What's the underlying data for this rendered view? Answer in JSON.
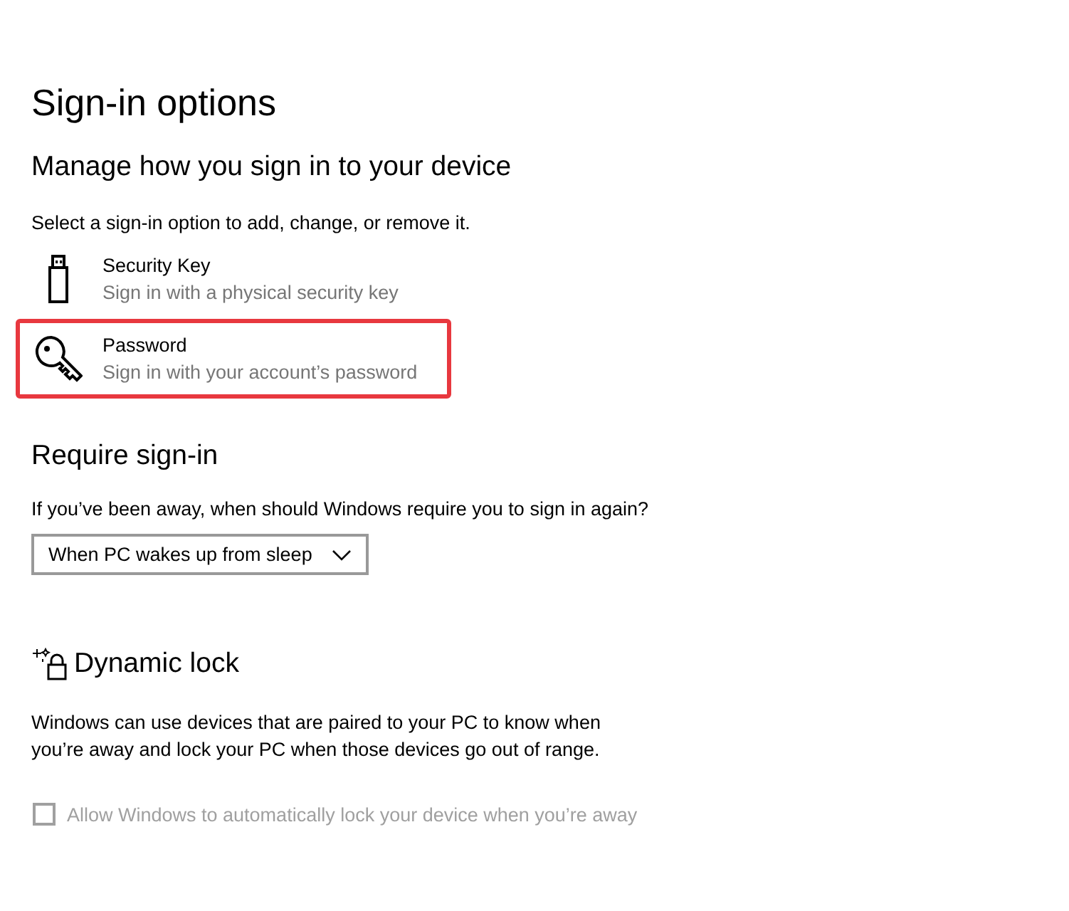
{
  "page": {
    "title": "Sign-in options"
  },
  "manage": {
    "heading": "Manage how you sign in to your device",
    "instruction": "Select a sign-in option to add, change, or remove it.",
    "options": [
      {
        "kind": "security-key",
        "title": "Security Key",
        "description": "Sign in with a physical security key",
        "highlighted": false
      },
      {
        "kind": "password",
        "title": "Password",
        "description": "Sign in with your account’s password",
        "highlighted": true
      }
    ]
  },
  "require": {
    "heading": "Require sign-in",
    "question": "If you’ve been away, when should Windows require you to sign in again?",
    "dropdown": {
      "value": "When PC wakes up from sleep"
    }
  },
  "dynamic_lock": {
    "heading": "Dynamic lock",
    "description": "Windows can use devices that are paired to your PC to know when you’re away and lock your PC when those devices go out of range.",
    "checkbox": {
      "label": "Allow Windows to automatically lock your device when you’re away",
      "checked": false,
      "disabled": true
    }
  }
}
